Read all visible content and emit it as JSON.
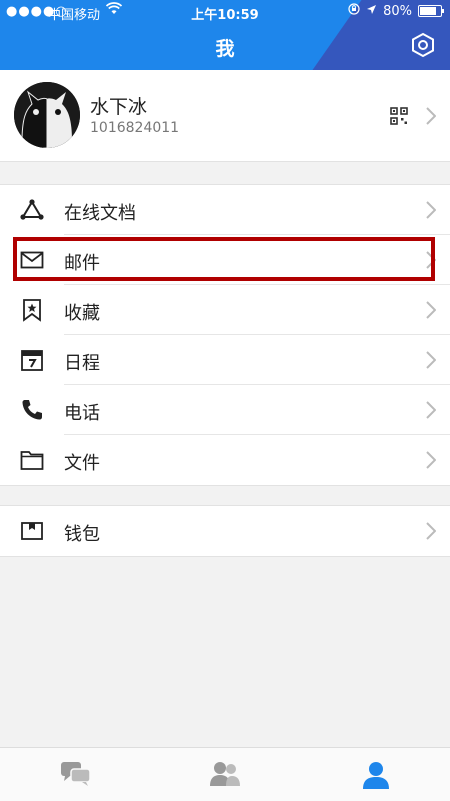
{
  "status_bar": {
    "signal": "●●●●○",
    "carrier": "中国移动",
    "time": "上午10:59",
    "battery_text": "80%",
    "battery_level": 0.8
  },
  "header": {
    "title": "我"
  },
  "profile": {
    "name": "水下冰",
    "user_id": "1016824011"
  },
  "menu_group_1": [
    {
      "id": "online-docs",
      "label": "在线文档",
      "icon": "triangle-nodes-icon"
    },
    {
      "id": "mail",
      "label": "邮件",
      "icon": "mail-icon"
    },
    {
      "id": "favorites",
      "label": "收藏",
      "icon": "bookmark-star-icon"
    },
    {
      "id": "schedule",
      "label": "日程",
      "icon": "calendar-icon"
    },
    {
      "id": "phone",
      "label": "电话",
      "icon": "phone-icon"
    },
    {
      "id": "files",
      "label": "文件",
      "icon": "folder-icon"
    }
  ],
  "menu_group_2": [
    {
      "id": "wallet",
      "label": "钱包",
      "icon": "wallet-icon"
    }
  ],
  "tabbar": {
    "tabs": [
      {
        "id": "messages",
        "icon": "chat-icon"
      },
      {
        "id": "contacts",
        "icon": "contacts-icon"
      },
      {
        "id": "me",
        "icon": "profile-icon"
      }
    ]
  },
  "colors": {
    "header_blue": "#1e86eb",
    "accent_dark": "#3a4fb5",
    "highlight": "#b00000",
    "text": "#222222"
  }
}
